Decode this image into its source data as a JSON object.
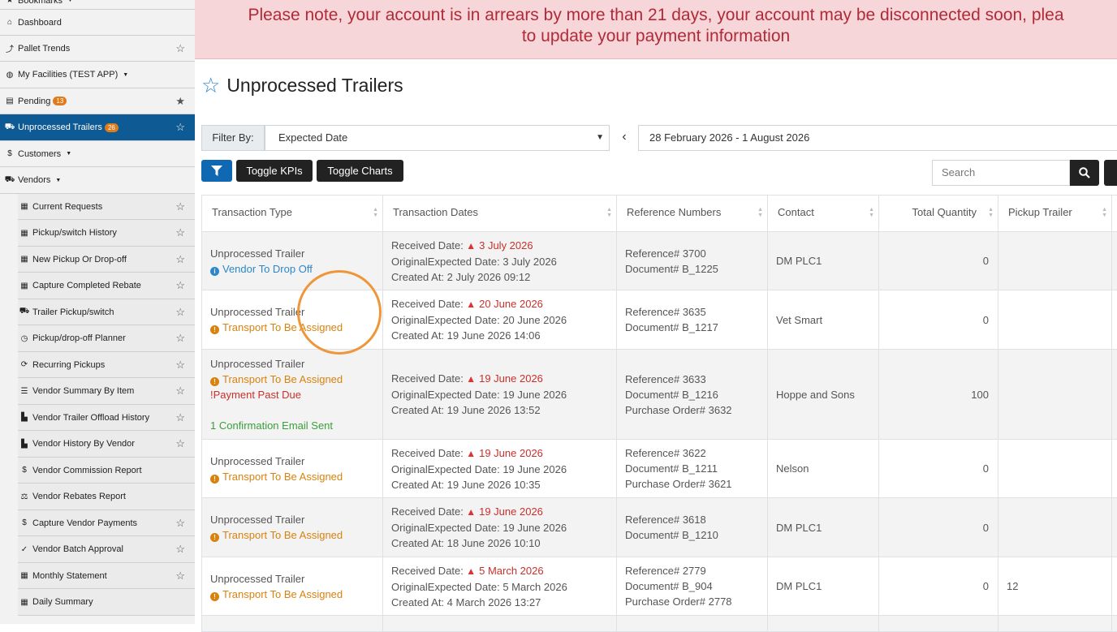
{
  "alert": {
    "line1": "Please note, your account is in arrears by more than 21 days, your account may be disconnected soon, plea",
    "line2": "to update your payment information"
  },
  "sidebar": {
    "items": [
      {
        "label": "Bookmarks",
        "icon": "star-icon",
        "glyph": "★",
        "caret": true
      },
      {
        "label": "Dashboard",
        "icon": "home-icon",
        "glyph": "⌂"
      },
      {
        "label": "Pallet Trends",
        "icon": "line-chart-icon",
        "glyph": "⤴",
        "star": true
      },
      {
        "label": "My Facilities (TEST APP)",
        "icon": "globe-icon",
        "glyph": "◍",
        "caret": true
      },
      {
        "label": "Pending",
        "icon": "clipboard-icon",
        "glyph": "▤",
        "badge": "13",
        "star": true,
        "starred": true
      },
      {
        "label": "Unprocessed Trailers",
        "icon": "truck-icon",
        "glyph": "⛟",
        "badge": "26",
        "star": true,
        "active": true
      },
      {
        "label": "Customers",
        "icon": "dollar-icon",
        "glyph": "$",
        "caret": true
      },
      {
        "label": "Vendors",
        "icon": "truck-icon",
        "glyph": "⛟",
        "caret": true
      }
    ],
    "subitems": [
      {
        "label": "Current Requests",
        "icon": "table-icon",
        "glyph": "▦",
        "star": true
      },
      {
        "label": "Pickup/switch History",
        "icon": "table-icon",
        "glyph": "▦",
        "star": true
      },
      {
        "label": "New Pickup Or Drop-off",
        "icon": "table-icon",
        "glyph": "▦",
        "star": true
      },
      {
        "label": "Capture Completed Rebate",
        "icon": "table-icon",
        "glyph": "▦",
        "star": true
      },
      {
        "label": "Trailer Pickup/switch",
        "icon": "truck-icon",
        "glyph": "⛟",
        "star": true
      },
      {
        "label": "Pickup/drop-off Planner",
        "icon": "clock-icon",
        "glyph": "◷",
        "star": true
      },
      {
        "label": "Recurring Pickups",
        "icon": "refresh-icon",
        "glyph": "⟳",
        "star": true
      },
      {
        "label": "Vendor Summary By Item",
        "icon": "list-icon",
        "glyph": "☰",
        "star": true
      },
      {
        "label": "Vendor Trailer Offload History",
        "icon": "chart-icon",
        "glyph": "▙",
        "star": true
      },
      {
        "label": "Vendor History By Vendor",
        "icon": "chart-icon",
        "glyph": "▙",
        "star": true
      },
      {
        "label": "Vendor Commission Report",
        "icon": "dollar-icon",
        "glyph": "$"
      },
      {
        "label": "Vendor Rebates Report",
        "icon": "balance-icon",
        "glyph": "⚖"
      },
      {
        "label": "Capture Vendor Payments",
        "icon": "dollar-icon",
        "glyph": "$",
        "star": true
      },
      {
        "label": "Vendor Batch Approval",
        "icon": "check-icon",
        "glyph": "✓",
        "star": true
      },
      {
        "label": "Monthly Statement",
        "icon": "table-icon",
        "glyph": "▦",
        "star": true
      },
      {
        "label": "Daily Summary",
        "icon": "table-icon",
        "glyph": "▦"
      }
    ]
  },
  "page": {
    "title": "Unprocessed Trailers"
  },
  "filter": {
    "label": "Filter By:",
    "selected": "Expected Date",
    "date_range": "28 February 2026 - 1 August 2026"
  },
  "toolbar": {
    "toggle_kpis": "Toggle KPIs",
    "toggle_charts": "Toggle Charts",
    "search_placeholder": "Search"
  },
  "table": {
    "headers": [
      "Transaction Type",
      "Transaction Dates",
      "Reference Numbers",
      "Contact",
      "Total Quantity",
      "Pickup Trailer"
    ],
    "rows": [
      {
        "type": "Unprocessed Trailer",
        "statuses": [
          {
            "text": "Vendor To Drop Off",
            "color": "blue"
          }
        ],
        "received": "3 July 2026",
        "original": "3 July 2026",
        "created": "2 July 2026 09:12",
        "refs": [
          "Reference# 3700",
          "Document# B_1225"
        ],
        "contact": "DM PLC1",
        "quantity": "0",
        "trailer": ""
      },
      {
        "type": "Unprocessed Trailer",
        "statuses": [
          {
            "text": "Transport To Be Assigned",
            "color": "orange"
          }
        ],
        "received": "20 June 2026",
        "original": "20 June 2026",
        "created": "19 June 2026 14:06",
        "refs": [
          "Reference# 3635",
          "Document# B_1217"
        ],
        "contact": "Vet Smart",
        "quantity": "0",
        "trailer": ""
      },
      {
        "type": "Unprocessed Trailer",
        "statuses": [
          {
            "text": "Transport To Be Assigned",
            "color": "orange"
          },
          {
            "text": "Payment Past Due",
            "color": "red",
            "prefix": "!"
          },
          {
            "text": "",
            "color": "none"
          },
          {
            "text": "1 Confirmation Email Sent",
            "color": "green"
          }
        ],
        "received": "19 June 2026",
        "original": "19 June 2026",
        "created": "19 June 2026 13:52",
        "refs": [
          "Reference# 3633",
          "Document# B_1216",
          "Purchase Order# 3632"
        ],
        "contact": "Hoppe and Sons",
        "quantity": "100",
        "trailer": ""
      },
      {
        "type": "Unprocessed Trailer",
        "statuses": [
          {
            "text": "Transport To Be Assigned",
            "color": "orange"
          }
        ],
        "received": "19 June 2026",
        "original": "19 June 2026",
        "created": "19 June 2026 10:35",
        "refs": [
          "Reference# 3622",
          "Document# B_1211",
          "Purchase Order# 3621"
        ],
        "contact": "Nelson",
        "quantity": "0",
        "trailer": ""
      },
      {
        "type": "Unprocessed Trailer",
        "statuses": [
          {
            "text": "Transport To Be Assigned",
            "color": "orange"
          }
        ],
        "received": "19 June 2026",
        "original": "19 June 2026",
        "created": "18 June 2026 10:10",
        "refs": [
          "Reference# 3618",
          "Document# B_1210"
        ],
        "contact": "DM PLC1",
        "quantity": "0",
        "trailer": ""
      },
      {
        "type": "Unprocessed Trailer",
        "statuses": [
          {
            "text": "Transport To Be Assigned",
            "color": "orange"
          }
        ],
        "received": "5 March 2026",
        "original": "5 March 2026",
        "created": "4 March 2026 13:27",
        "refs": [
          "Reference# 2779",
          "Document# B_904",
          "Purchase Order# 2778"
        ],
        "contact": "DM PLC1",
        "quantity": "0",
        "trailer": "12"
      }
    ],
    "labels": {
      "received": "Received Date:",
      "original": "OriginalExpected Date:",
      "created": "Created At:"
    }
  }
}
